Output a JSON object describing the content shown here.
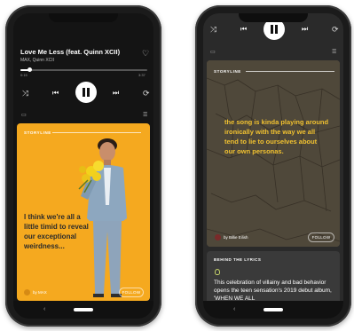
{
  "phone1": {
    "track": {
      "title": "Love Me Less (feat. Quinn XCII)",
      "artist": "MAX, Quinn XCII",
      "time_elapsed": "0:15",
      "time_total": "3:37",
      "progress": 0.07
    },
    "storyline": {
      "label": "STORYLINE",
      "quote": "I think we're all a little timid to reveal our exceptional weirdness...",
      "by": "by MAX",
      "follow": "FOLLOW"
    },
    "colors": {
      "card": "#f5a91f",
      "quote": "#2b2b2b"
    },
    "icons": [
      "heart-icon",
      "shuffle-icon",
      "previous-icon",
      "pause-icon",
      "next-icon",
      "repeat-icon",
      "devices-icon",
      "queue-icon",
      "back-arrow-icon"
    ]
  },
  "phone2": {
    "storyline": {
      "label": "STORYLINE",
      "quote": "the song is kinda playing around ironically with the way we all tend to lie to ourselves about our own personas.",
      "by": "by Billie Eilish",
      "follow": "FOLLOW"
    },
    "behind": {
      "label": "BEHIND THE LYRICS",
      "text": "This celebration of villainy and bad behavior opens the teen sensation's 2019 debut album, 'WHEN WE ALL"
    },
    "colors": {
      "quote": "#f2c230",
      "card_bg": "#5b5242",
      "behind_icon": "#c6d36a"
    }
  }
}
